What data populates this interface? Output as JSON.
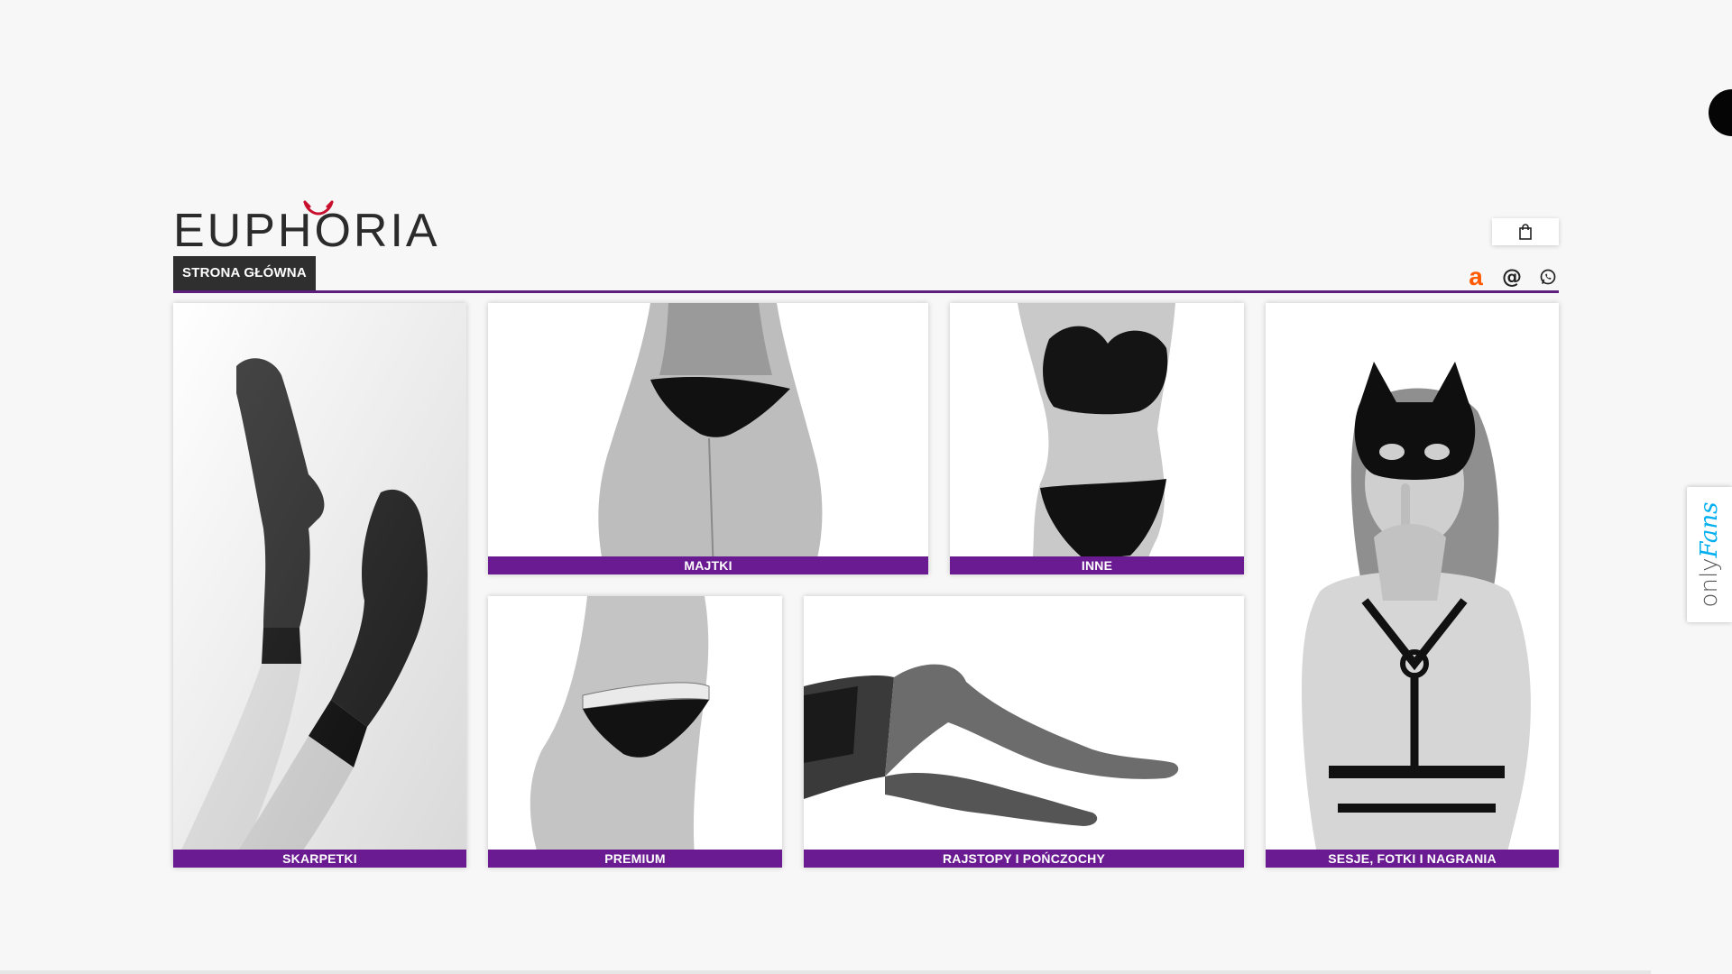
{
  "brand": {
    "name": "EUPHORIA",
    "horns_color": "#c8102e",
    "accent_color": "#6a1b91"
  },
  "nav": {
    "home_label": "STRONA GŁÓWNA"
  },
  "header_icons": {
    "cart": "shopping-bag-icon",
    "allegro": "a",
    "email": "@",
    "whatsapp": "whatsapp-icon"
  },
  "tiles": [
    {
      "label": "SKARPETKI"
    },
    {
      "label": "MAJTKI"
    },
    {
      "label": "INNE"
    },
    {
      "label": "SESJE, FOTKI I NAGRANIA"
    },
    {
      "label": "PREMIUM"
    },
    {
      "label": "RAJSTOPY I POŃCZOCHY"
    }
  ],
  "side_widget": {
    "only": "only",
    "fans": "Fans"
  }
}
